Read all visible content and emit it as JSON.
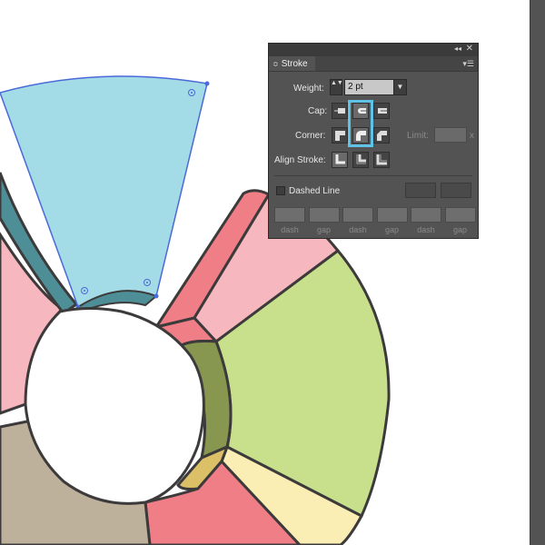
{
  "canvas": {
    "background": "#ffffff",
    "chart_segment_colors": {
      "blue": "#a3dbe6",
      "blue_side": "#4e8f97",
      "pink": "#f7b7bf",
      "pink_side": "#ef7e87",
      "green": "#c8df8c",
      "green_side": "#88974f",
      "yellow": "#fbeeb4",
      "yellow_side": "#dcc067",
      "tan": "#beb19c",
      "stroke": "#3c3a3a",
      "selection": "#4a6ad8"
    }
  },
  "panel": {
    "collapse_icon": "◂◂",
    "close_icon": "✕",
    "tab_grip": "≎",
    "tab_label": "Stroke",
    "menu_icon": "▾☰",
    "weight": {
      "label": "Weight:",
      "value": "2 pt",
      "stepper_icon": "▲▼",
      "dropdown_icon": "▼"
    },
    "cap": {
      "label": "Cap:",
      "selected": "round-cap"
    },
    "corner": {
      "label": "Corner:",
      "selected": "round-join"
    },
    "limit": {
      "label": "Limit:",
      "suffix": "x",
      "value": ""
    },
    "align": {
      "label": "Align Stroke:",
      "selected": "center"
    },
    "dashed_line": {
      "label": "Dashed Line",
      "checked": false
    },
    "dash_fields": [
      {
        "label": "dash",
        "value": ""
      },
      {
        "label": "gap",
        "value": ""
      },
      {
        "label": "dash",
        "value": ""
      },
      {
        "label": "gap",
        "value": ""
      },
      {
        "label": "dash",
        "value": ""
      },
      {
        "label": "gap",
        "value": ""
      }
    ]
  }
}
